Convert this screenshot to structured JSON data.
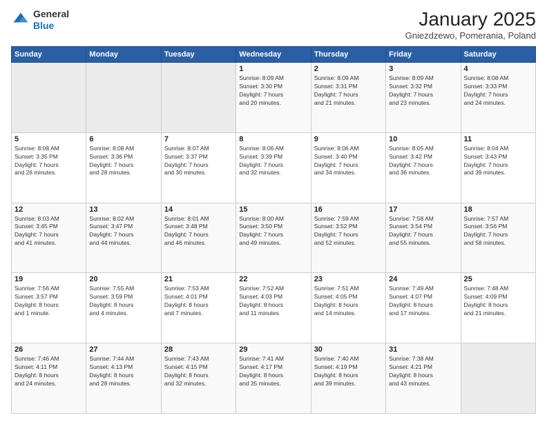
{
  "header": {
    "logo_line1": "General",
    "logo_line2": "Blue",
    "title": "January 2025",
    "subtitle": "Gniezdzewo, Pomerania, Poland"
  },
  "weekdays": [
    "Sunday",
    "Monday",
    "Tuesday",
    "Wednesday",
    "Thursday",
    "Friday",
    "Saturday"
  ],
  "weeks": [
    [
      {
        "day": "",
        "info": ""
      },
      {
        "day": "",
        "info": ""
      },
      {
        "day": "",
        "info": ""
      },
      {
        "day": "1",
        "info": "Sunrise: 8:09 AM\nSunset: 3:30 PM\nDaylight: 7 hours\nand 20 minutes."
      },
      {
        "day": "2",
        "info": "Sunrise: 8:09 AM\nSunset: 3:31 PM\nDaylight: 7 hours\nand 21 minutes."
      },
      {
        "day": "3",
        "info": "Sunrise: 8:09 AM\nSunset: 3:32 PM\nDaylight: 7 hours\nand 23 minutes."
      },
      {
        "day": "4",
        "info": "Sunrise: 8:08 AM\nSunset: 3:33 PM\nDaylight: 7 hours\nand 24 minutes."
      }
    ],
    [
      {
        "day": "5",
        "info": "Sunrise: 8:08 AM\nSunset: 3:35 PM\nDaylight: 7 hours\nand 26 minutes."
      },
      {
        "day": "6",
        "info": "Sunrise: 8:08 AM\nSunset: 3:36 PM\nDaylight: 7 hours\nand 28 minutes."
      },
      {
        "day": "7",
        "info": "Sunrise: 8:07 AM\nSunset: 3:37 PM\nDaylight: 7 hours\nand 30 minutes."
      },
      {
        "day": "8",
        "info": "Sunrise: 8:06 AM\nSunset: 3:39 PM\nDaylight: 7 hours\nand 32 minutes."
      },
      {
        "day": "9",
        "info": "Sunrise: 8:06 AM\nSunset: 3:40 PM\nDaylight: 7 hours\nand 34 minutes."
      },
      {
        "day": "10",
        "info": "Sunrise: 8:05 AM\nSunset: 3:42 PM\nDaylight: 7 hours\nand 36 minutes."
      },
      {
        "day": "11",
        "info": "Sunrise: 8:04 AM\nSunset: 3:43 PM\nDaylight: 7 hours\nand 39 minutes."
      }
    ],
    [
      {
        "day": "12",
        "info": "Sunrise: 8:03 AM\nSunset: 3:45 PM\nDaylight: 7 hours\nand 41 minutes."
      },
      {
        "day": "13",
        "info": "Sunrise: 8:02 AM\nSunset: 3:47 PM\nDaylight: 7 hours\nand 44 minutes."
      },
      {
        "day": "14",
        "info": "Sunrise: 8:01 AM\nSunset: 3:48 PM\nDaylight: 7 hours\nand 46 minutes."
      },
      {
        "day": "15",
        "info": "Sunrise: 8:00 AM\nSunset: 3:50 PM\nDaylight: 7 hours\nand 49 minutes."
      },
      {
        "day": "16",
        "info": "Sunrise: 7:59 AM\nSunset: 3:52 PM\nDaylight: 7 hours\nand 52 minutes."
      },
      {
        "day": "17",
        "info": "Sunrise: 7:58 AM\nSunset: 3:54 PM\nDaylight: 7 hours\nand 55 minutes."
      },
      {
        "day": "18",
        "info": "Sunrise: 7:57 AM\nSunset: 3:56 PM\nDaylight: 7 hours\nand 58 minutes."
      }
    ],
    [
      {
        "day": "19",
        "info": "Sunrise: 7:56 AM\nSunset: 3:57 PM\nDaylight: 8 hours\nand 1 minute."
      },
      {
        "day": "20",
        "info": "Sunrise: 7:55 AM\nSunset: 3:59 PM\nDaylight: 8 hours\nand 4 minutes."
      },
      {
        "day": "21",
        "info": "Sunrise: 7:53 AM\nSunset: 4:01 PM\nDaylight: 8 hours\nand 7 minutes."
      },
      {
        "day": "22",
        "info": "Sunrise: 7:52 AM\nSunset: 4:03 PM\nDaylight: 8 hours\nand 11 minutes."
      },
      {
        "day": "23",
        "info": "Sunrise: 7:51 AM\nSunset: 4:05 PM\nDaylight: 8 hours\nand 14 minutes."
      },
      {
        "day": "24",
        "info": "Sunrise: 7:49 AM\nSunset: 4:07 PM\nDaylight: 8 hours\nand 17 minutes."
      },
      {
        "day": "25",
        "info": "Sunrise: 7:48 AM\nSunset: 4:09 PM\nDaylight: 8 hours\nand 21 minutes."
      }
    ],
    [
      {
        "day": "26",
        "info": "Sunrise: 7:46 AM\nSunset: 4:11 PM\nDaylight: 8 hours\nand 24 minutes."
      },
      {
        "day": "27",
        "info": "Sunrise: 7:44 AM\nSunset: 4:13 PM\nDaylight: 8 hours\nand 28 minutes."
      },
      {
        "day": "28",
        "info": "Sunrise: 7:43 AM\nSunset: 4:15 PM\nDaylight: 8 hours\nand 32 minutes."
      },
      {
        "day": "29",
        "info": "Sunrise: 7:41 AM\nSunset: 4:17 PM\nDaylight: 8 hours\nand 35 minutes."
      },
      {
        "day": "30",
        "info": "Sunrise: 7:40 AM\nSunset: 4:19 PM\nDaylight: 8 hours\nand 39 minutes."
      },
      {
        "day": "31",
        "info": "Sunrise: 7:38 AM\nSunset: 4:21 PM\nDaylight: 8 hours\nand 43 minutes."
      },
      {
        "day": "",
        "info": ""
      }
    ]
  ]
}
